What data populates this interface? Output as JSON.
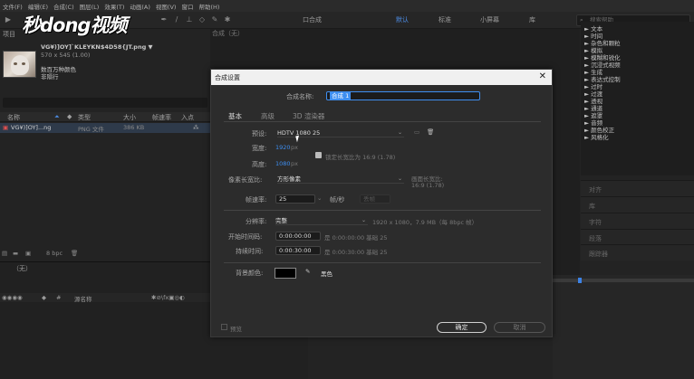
{
  "menubar": {
    "items": [
      "文件(F)",
      "编辑(E)",
      "合成(C)",
      "图层(L)",
      "效果(T)",
      "动画(A)",
      "视图(V)",
      "窗口",
      "帮助(H)"
    ]
  },
  "toolbar": {
    "workspaces": [
      "默认",
      "标准",
      "小屏幕",
      "库"
    ],
    "active_workspace": "默认",
    "search_placeholder": "搜索帮助",
    "comp_label": "口合成",
    "accent": "#4d8ee8"
  },
  "logo": {
    "text": "秒dong视频"
  },
  "project": {
    "tab_label": "项目",
    "file_title": "VG¥)]OY]`KLEYKN$4D58{JT.png ▼",
    "file_dims": "570 x 545 (1.00)",
    "color_info": "数百万种颜色",
    "interlace": "非隔行",
    "columns": [
      "名称",
      "类型",
      "大小",
      "帧速率",
      "入点"
    ],
    "row": {
      "name": "VG¥)]OY]...ng",
      "type": "PNG 文件",
      "size": "386 KB"
    },
    "bpc": "8 bpc"
  },
  "viewer": {
    "tab_label": "合成（无）"
  },
  "timeline": {
    "tab_label": "（无）",
    "source_name_col": "源名称"
  },
  "effects": {
    "items": [
      "► 文本",
      "► 时间",
      "► 杂色和颗粒",
      "► 模拟",
      "► 模糊和锐化",
      "► 沉浸式视频",
      "► 生成",
      "► 表达式控制",
      "► 过时",
      "► 过渡",
      "► 透视",
      "► 通道",
      "► 遮罩",
      "► 音频",
      "► 颜色校正",
      "► 风格化"
    ],
    "lower_tabs": [
      "对齐",
      "库",
      "字符",
      "段落",
      "跟踪器"
    ]
  },
  "dialog": {
    "title": "合成设置",
    "close_label": "✕",
    "name_label": "合成名称:",
    "name_value": "合成 1",
    "tabs": [
      "基本",
      "高级",
      "3D 渲染器"
    ],
    "preset_label": "预设:",
    "preset_value": "HDTV 1080 25",
    "width_label": "宽度:",
    "width_value": "1920",
    "height_label": "高度:",
    "height_value": "1080",
    "px": "px",
    "lock_ratio": "锁定长宽比为 16:9 (1.78)",
    "par_label": "像素长宽比:",
    "par_value": "方形像素",
    "frame_ratio_label": "画面长宽比:",
    "frame_ratio_value": "16:9 (1.78)",
    "fps_label": "帧速率:",
    "fps_value": "25",
    "fps_unit": "帧/秒",
    "drop_frame": "丢帧",
    "res_label": "分辨率:",
    "res_value": "完整",
    "res_info": "1920 x 1080，7.9 MB（每 8bpc 帧）",
    "start_label": "开始时间码:",
    "start_value": "0:00:00:00",
    "start_info": "是 0:00:00:00 基础 25",
    "dur_label": "持续时间:",
    "dur_value": "0:00:30:00",
    "dur_info": "是 0:00:30:00 基础 25",
    "bg_label": "背景颜色:",
    "bg_name": "黑色",
    "preview_label": "预览",
    "ok_label": "确定",
    "cancel_label": "取消",
    "link_color": "#3e8ef0"
  }
}
